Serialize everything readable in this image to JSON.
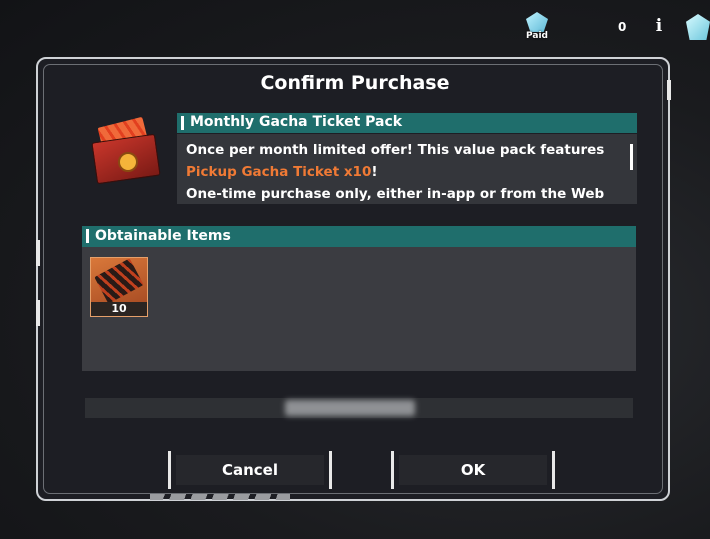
{
  "topbar": {
    "paid_label": "Paid",
    "currency_count": "0",
    "info_label": "i",
    "icons": [
      "paid-gem-icon",
      "info-icon",
      "gem-icon"
    ]
  },
  "dialog": {
    "title": "Confirm Purchase",
    "pack": {
      "name": "Monthly Gacha Ticket Pack",
      "desc_line1": "Once per month limited offer! This value pack features",
      "desc_highlight": "Pickup Gacha Ticket x10",
      "desc_after_highlight": "!",
      "desc_line3": "One-time purchase only, either in-app or from the Web"
    },
    "obtainable": {
      "title": "Obtainable Items",
      "items": [
        {
          "icon": "gacha-ticket-icon",
          "count": "10"
        }
      ]
    },
    "buttons": {
      "cancel": "Cancel",
      "ok": "OK"
    }
  },
  "colors": {
    "header_teal": "#1f6e6c",
    "highlight_orange": "#f07a35",
    "panel_bg": "#3b3c41"
  }
}
